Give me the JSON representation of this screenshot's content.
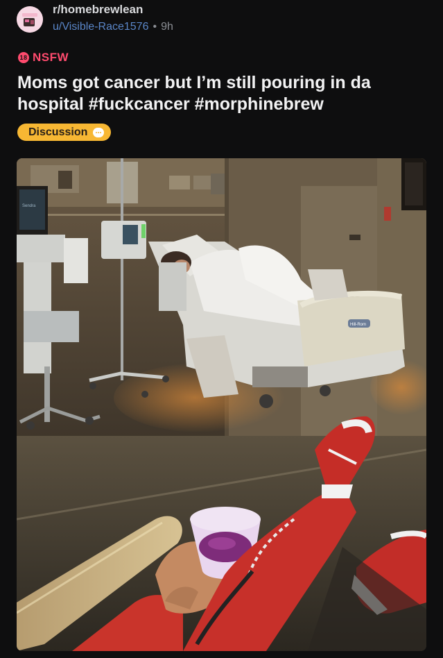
{
  "post": {
    "subreddit": "r/homebrewlean",
    "username": "u/Visible-Race1576",
    "separator": "•",
    "age": "9h",
    "nsfw_badge": "18",
    "nsfw_label": "NSFW",
    "title": "Moms got cancer but I’m still pouring in da hospital #fuckcancer #morphinebrew",
    "flair": "Discussion",
    "bed_brand_text": "Hill-Rom",
    "monitor_text": "Sendra"
  },
  "colors": {
    "background": "#0e0e0f",
    "username": "#5a86c8",
    "nsfw": "#ff4b6e",
    "flair": "#f7b733"
  },
  "icons": {
    "avatar": "subreddit-avatar",
    "nsfw": "nsfw-18-icon",
    "flair": "chat-bubble-icon"
  }
}
